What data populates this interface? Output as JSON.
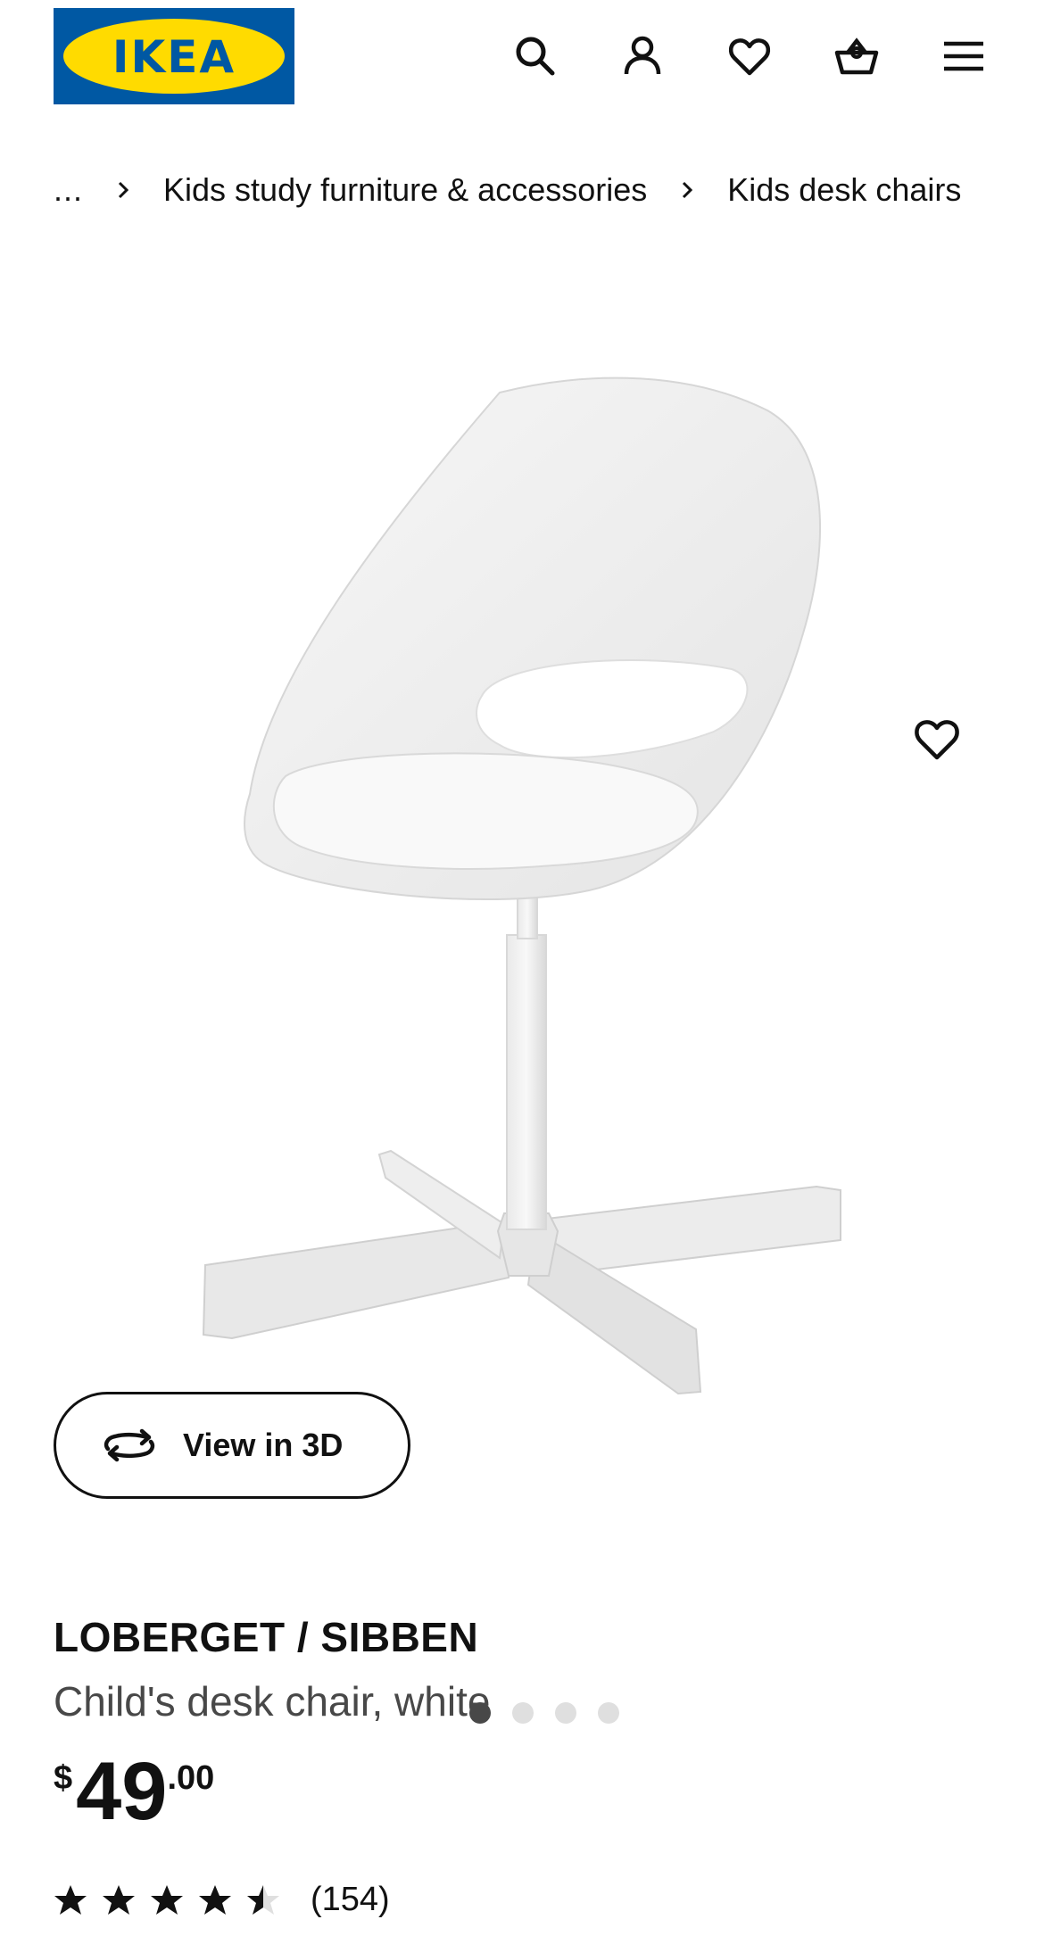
{
  "brand": {
    "logo_text": "IKEA",
    "colors": {
      "blue": "#0058a3",
      "yellow": "#ffdb00"
    }
  },
  "header": {
    "icons": [
      "search-icon",
      "account-icon",
      "heart-icon",
      "basket-icon",
      "menu-icon"
    ]
  },
  "breadcrumb": {
    "ellipsis": "...",
    "items": [
      "Kids study furniture & accessories",
      "Kids desk chairs"
    ]
  },
  "gallery": {
    "view3d_label": "View in 3D",
    "image_count": 4,
    "active_index": 0
  },
  "product": {
    "name": "LOBERGET / SIBBEN",
    "description": "Child's desk chair, white",
    "price": {
      "currency": "$",
      "integer": "49",
      "decimal": ".00"
    },
    "rating": {
      "value": 4.5,
      "max": 5,
      "count": "(154)"
    }
  }
}
